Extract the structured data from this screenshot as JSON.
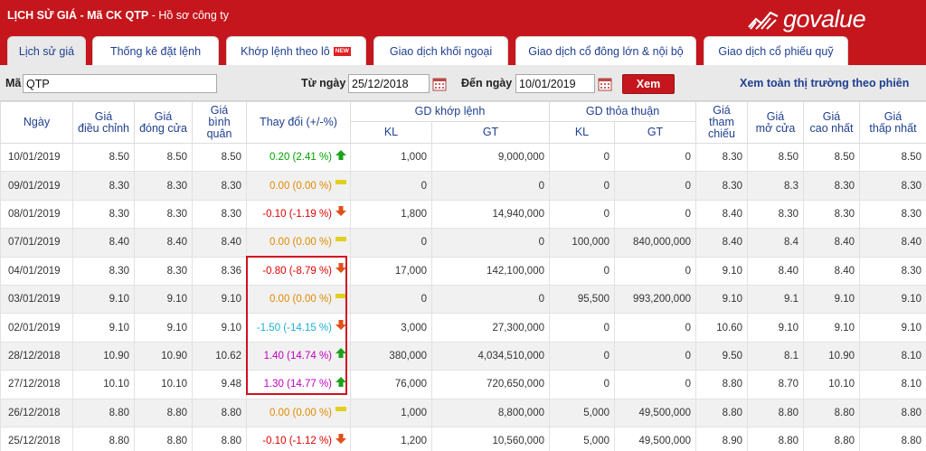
{
  "header": {
    "title_main": "LỊCH SỬ GIÁ - Mã CK QTP",
    "title_sep": " - ",
    "title_sub": "Hồ sơ công ty",
    "logo_text": "govalue"
  },
  "tabs": [
    {
      "label": "Lịch sử giá",
      "active": true
    },
    {
      "label": "Thống kê đặt lệnh",
      "active": false
    },
    {
      "label": "Khớp lệnh theo lô",
      "badge": "NEW",
      "active": false
    },
    {
      "label": "Giao dịch khối ngoại",
      "active": false
    },
    {
      "label": "Giao dịch cổ đông lớn & nội bộ",
      "active": false
    },
    {
      "label": "Giao dịch cổ phiếu quỹ",
      "active": false
    }
  ],
  "filter": {
    "ma_label": "Mã",
    "ma_value": "QTP",
    "from_label": "Từ ngày",
    "from_value": "25/12/2018",
    "to_label": "Đến ngày",
    "to_value": "10/01/2019",
    "button": "Xem",
    "link": "Xem toàn thị trường theo phiên"
  },
  "table": {
    "headers": {
      "ngay": "Ngày",
      "gia_dieu_chinh": [
        "Giá",
        "điều chỉnh"
      ],
      "gia_dong_cua": [
        "Giá",
        "đóng cửa"
      ],
      "gia_binh_quan": [
        "Giá",
        "bình",
        "quân"
      ],
      "thay_doi": "Thay đổi (+/-%)",
      "gd_khop_lenh": "GD khớp lệnh",
      "gd_thoa_thuan": "GD thỏa thuận",
      "kl": "KL",
      "gt": "GT",
      "gia_tham_chieu": [
        "Giá",
        "tham",
        "chiếu"
      ],
      "gia_mo_cua": [
        "Giá",
        "mở cửa"
      ],
      "gia_cao_nhat": [
        "Giá",
        "cao nhất"
      ],
      "gia_thap_nhat": [
        "Giá",
        "thấp nhất"
      ]
    },
    "rows": [
      {
        "date": "10/01/2019",
        "adj": "8.50",
        "close": "8.50",
        "avg": "8.50",
        "change": "0.20 (2.41 %)",
        "dir": "up",
        "color": "up",
        "kl_khop": "1,000",
        "gt_khop": "9,000,000",
        "kl_tt": "0",
        "gt_tt": "0",
        "ref": "8.30",
        "open": "8.50",
        "high": "8.50",
        "low": "8.50"
      },
      {
        "date": "09/01/2019",
        "adj": "8.30",
        "close": "8.30",
        "avg": "8.30",
        "change": "0.00 (0.00 %)",
        "dir": "flat",
        "color": "flat",
        "kl_khop": "0",
        "gt_khop": "0",
        "kl_tt": "0",
        "gt_tt": "0",
        "ref": "8.30",
        "open": "8.3",
        "high": "8.30",
        "low": "8.30"
      },
      {
        "date": "08/01/2019",
        "adj": "8.30",
        "close": "8.30",
        "avg": "8.30",
        "change": "-0.10 (-1.19 %)",
        "dir": "down",
        "color": "down",
        "kl_khop": "1,800",
        "gt_khop": "14,940,000",
        "kl_tt": "0",
        "gt_tt": "0",
        "ref": "8.40",
        "open": "8.30",
        "high": "8.30",
        "low": "8.30"
      },
      {
        "date": "07/01/2019",
        "adj": "8.40",
        "close": "8.40",
        "avg": "8.40",
        "change": "0.00 (0.00 %)",
        "dir": "flat",
        "color": "flat",
        "kl_khop": "0",
        "gt_khop": "0",
        "kl_tt": "100,000",
        "gt_tt": "840,000,000",
        "ref": "8.40",
        "open": "8.4",
        "high": "8.40",
        "low": "8.40"
      },
      {
        "date": "04/01/2019",
        "adj": "8.30",
        "close": "8.30",
        "avg": "8.36",
        "change": "-0.80 (-8.79 %)",
        "dir": "down",
        "color": "down",
        "kl_khop": "17,000",
        "gt_khop": "142,100,000",
        "kl_tt": "0",
        "gt_tt": "0",
        "ref": "9.10",
        "open": "8.40",
        "high": "8.40",
        "low": "8.30"
      },
      {
        "date": "03/01/2019",
        "adj": "9.10",
        "close": "9.10",
        "avg": "9.10",
        "change": "0.00 (0.00 %)",
        "dir": "flat",
        "color": "flat",
        "kl_khop": "0",
        "gt_khop": "0",
        "kl_tt": "95,500",
        "gt_tt": "993,200,000",
        "ref": "9.10",
        "open": "9.1",
        "high": "9.10",
        "low": "9.10"
      },
      {
        "date": "02/01/2019",
        "adj": "9.10",
        "close": "9.10",
        "avg": "9.10",
        "change": "-1.50 (-14.15 %)",
        "dir": "down",
        "color": "cyan",
        "kl_khop": "3,000",
        "gt_khop": "27,300,000",
        "kl_tt": "0",
        "gt_tt": "0",
        "ref": "10.60",
        "open": "9.10",
        "high": "9.10",
        "low": "9.10"
      },
      {
        "date": "28/12/2018",
        "adj": "10.90",
        "close": "10.90",
        "avg": "10.62",
        "change": "1.40 (14.74 %)",
        "dir": "up",
        "color": "mag",
        "kl_khop": "380,000",
        "gt_khop": "4,034,510,000",
        "kl_tt": "0",
        "gt_tt": "0",
        "ref": "9.50",
        "open": "8.1",
        "high": "10.90",
        "low": "8.10"
      },
      {
        "date": "27/12/2018",
        "adj": "10.10",
        "close": "10.10",
        "avg": "9.48",
        "change": "1.30 (14.77 %)",
        "dir": "up",
        "color": "mag",
        "kl_khop": "76,000",
        "gt_khop": "720,650,000",
        "kl_tt": "0",
        "gt_tt": "0",
        "ref": "8.80",
        "open": "8.70",
        "high": "10.10",
        "low": "8.10"
      },
      {
        "date": "26/12/2018",
        "adj": "8.80",
        "close": "8.80",
        "avg": "8.80",
        "change": "0.00 (0.00 %)",
        "dir": "flat",
        "color": "flat",
        "kl_khop": "1,000",
        "gt_khop": "8,800,000",
        "kl_tt": "5,000",
        "gt_tt": "49,500,000",
        "ref": "8.80",
        "open": "8.80",
        "high": "8.80",
        "low": "8.80"
      },
      {
        "date": "25/12/2018",
        "adj": "8.80",
        "close": "8.80",
        "avg": "8.80",
        "change": "-0.10 (-1.12 %)",
        "dir": "down",
        "color": "down",
        "kl_khop": "1,200",
        "gt_khop": "10,560,000",
        "kl_tt": "5,000",
        "gt_tt": "49,500,000",
        "ref": "8.90",
        "open": "8.80",
        "high": "8.80",
        "low": "8.80"
      }
    ]
  },
  "colors": {
    "brand_red": "#c4161c",
    "up": "#00a300",
    "down": "#e00000",
    "flat": "#e08a00",
    "ceiling": "#c000c0",
    "floor": "#1ab0d8",
    "header_text": "#1f3f8f"
  }
}
